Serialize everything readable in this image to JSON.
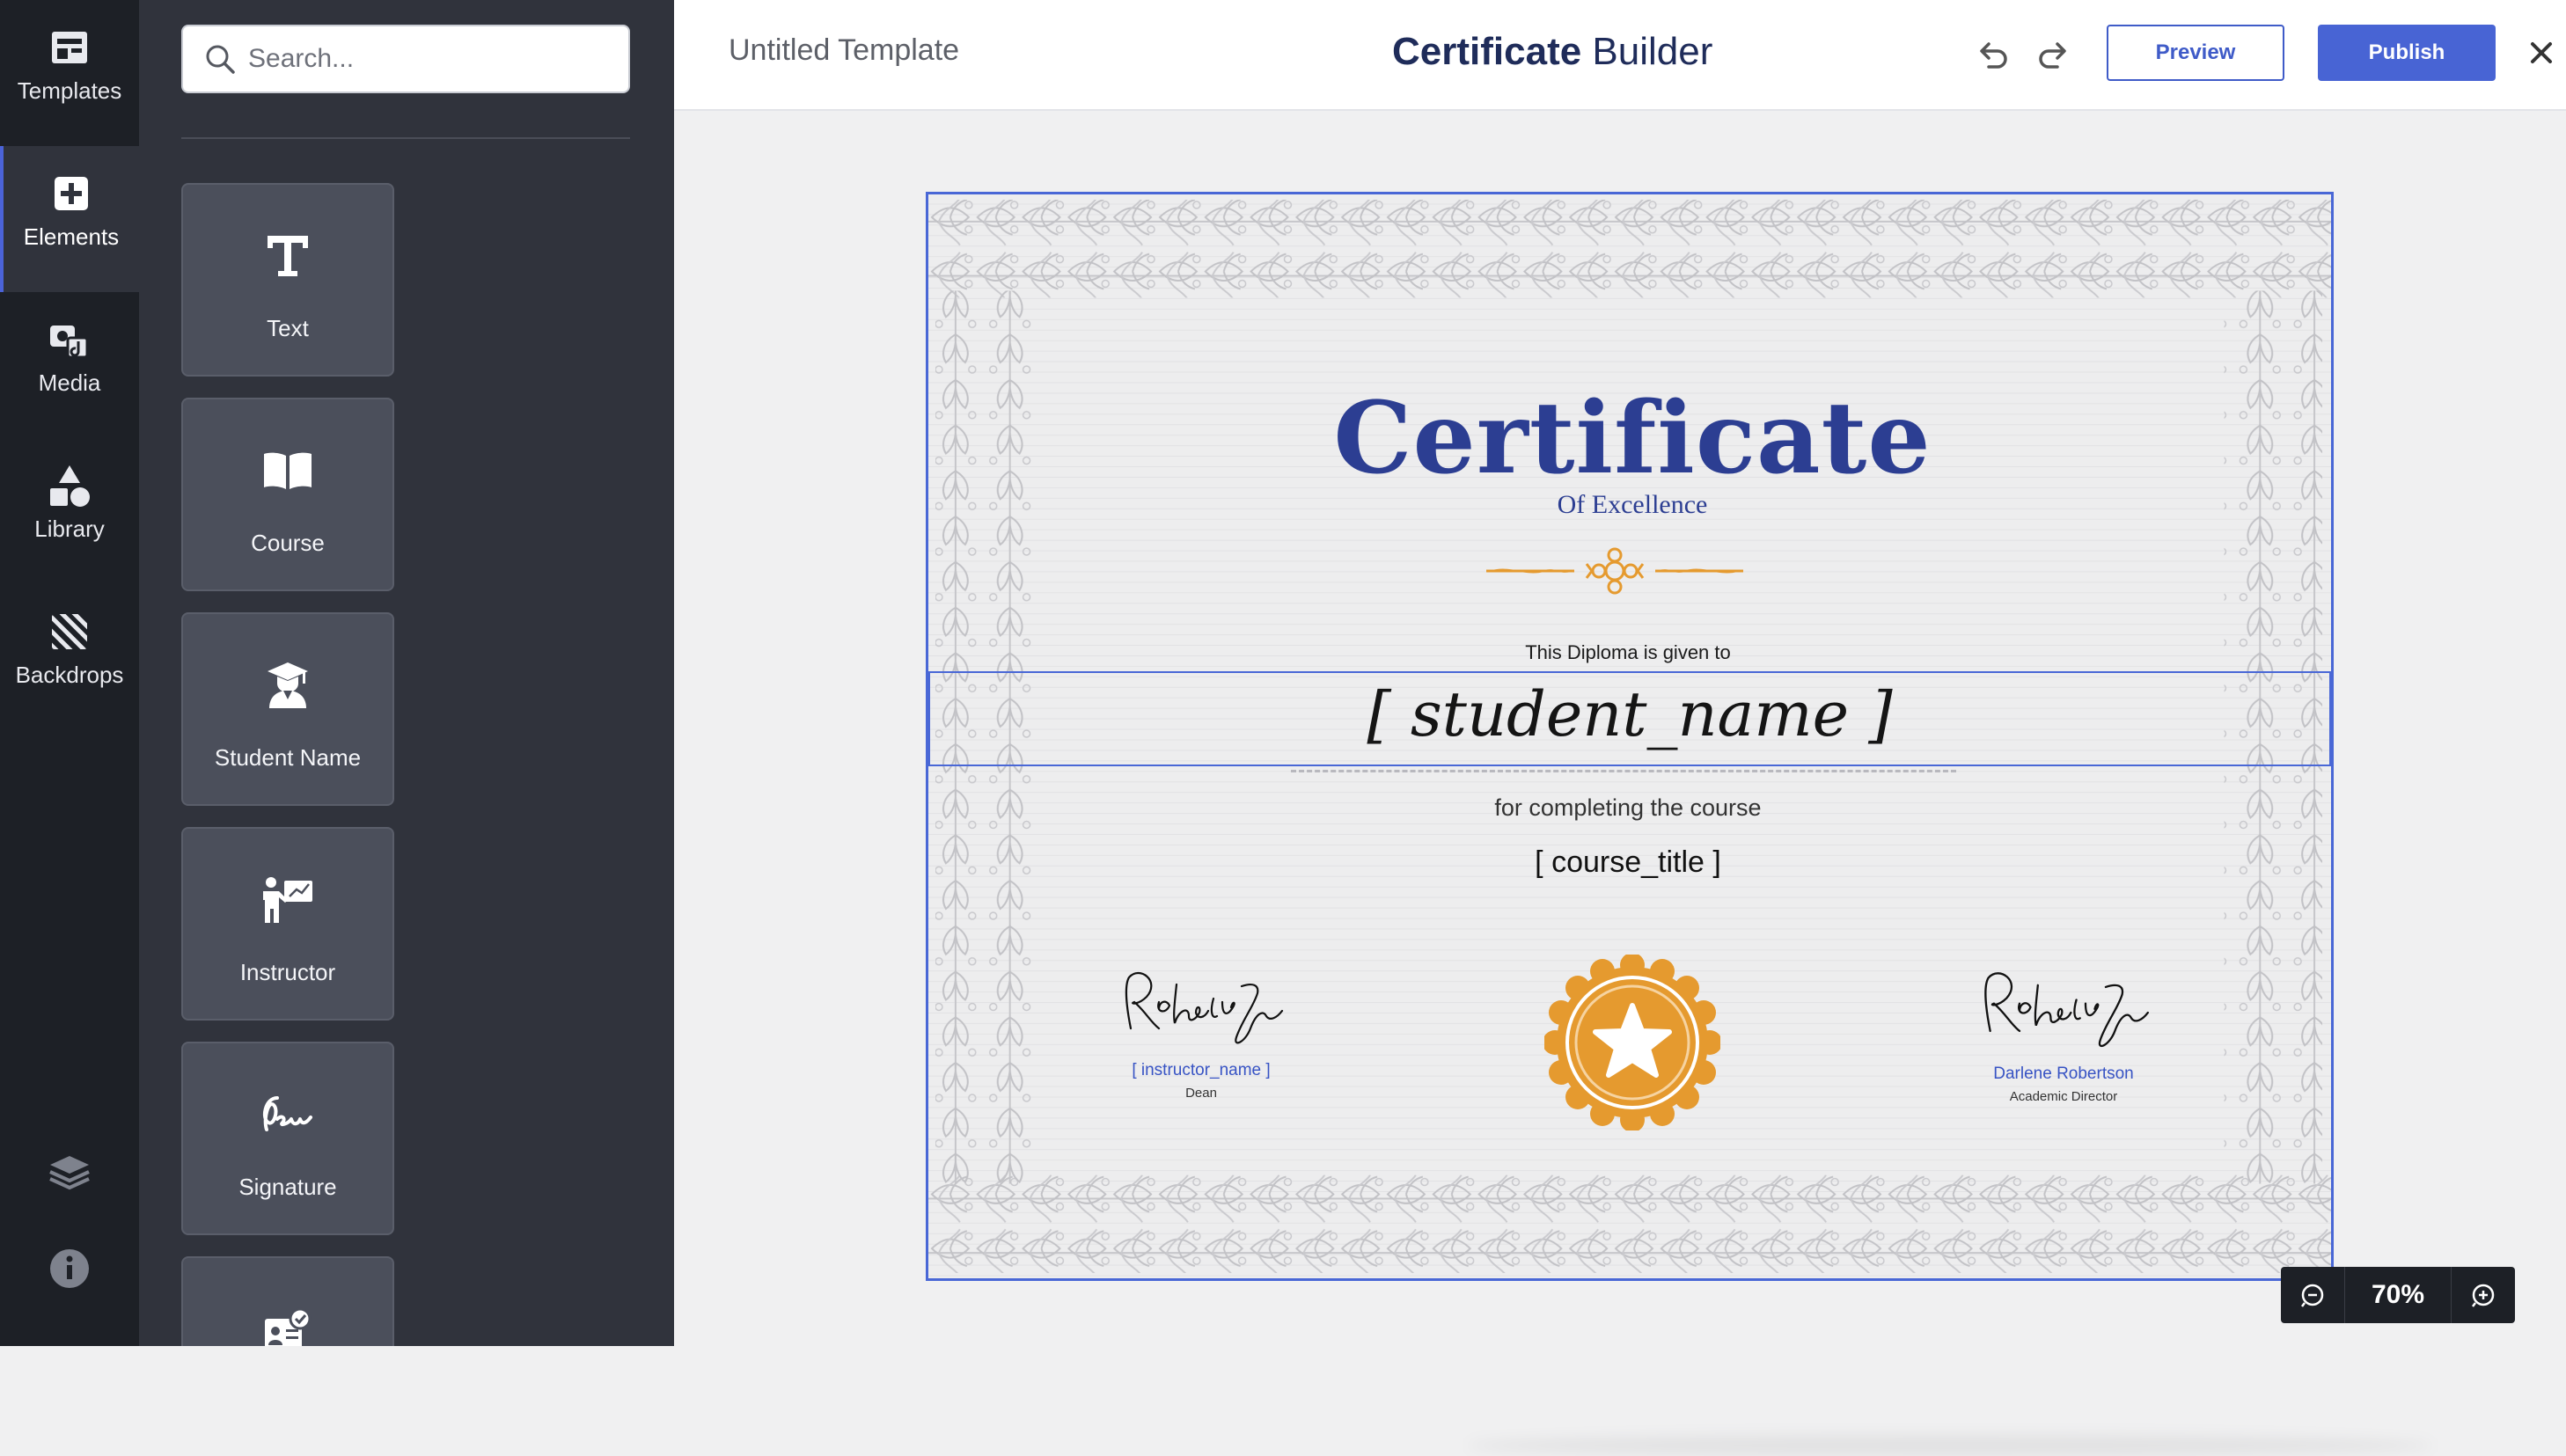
{
  "rail": {
    "items": [
      {
        "label": "Templates",
        "icon": "templates-icon"
      },
      {
        "label": "Elements",
        "icon": "add-square-icon",
        "active": true
      },
      {
        "label": "Media",
        "icon": "media-icon"
      },
      {
        "label": "Library",
        "icon": "shapes-icon"
      },
      {
        "label": "Backdrops",
        "icon": "hatch-icon"
      }
    ],
    "bottom_icons": [
      "layers-icon",
      "info-icon"
    ]
  },
  "panel": {
    "search_placeholder": "Search...",
    "elements": [
      {
        "label": "Text",
        "icon": "text-icon"
      },
      {
        "label": "Course",
        "icon": "book-icon"
      },
      {
        "label": "Student Name",
        "icon": "graduate-icon"
      },
      {
        "label": "Instructor",
        "icon": "instructor-icon"
      },
      {
        "label": "Signature",
        "icon": "signature-icon"
      },
      {
        "label": "",
        "icon": "id-card-check-icon"
      }
    ]
  },
  "topbar": {
    "doc_title": "Untitled Template",
    "app_title_bold": "Certificate",
    "app_title_rest": " Builder",
    "preview_label": "Preview",
    "publish_label": "Publish"
  },
  "certificate": {
    "title": "Certificate",
    "subtitle": "Of Excellence",
    "given_to": "This Diploma is given to",
    "student_name": "[ student_name ]",
    "completing": "for completing the course",
    "course_title": "[ course_title ]",
    "signatures": [
      {
        "name": "[ instructor_name ]",
        "role": "Dean"
      },
      {
        "name": "Darlene Robertson",
        "role": "Academic Director"
      }
    ],
    "colors": {
      "title": "#2c3e92",
      "accent": "#e59a2f",
      "border": "#4967d6"
    }
  },
  "zoom": {
    "value": "70%"
  }
}
